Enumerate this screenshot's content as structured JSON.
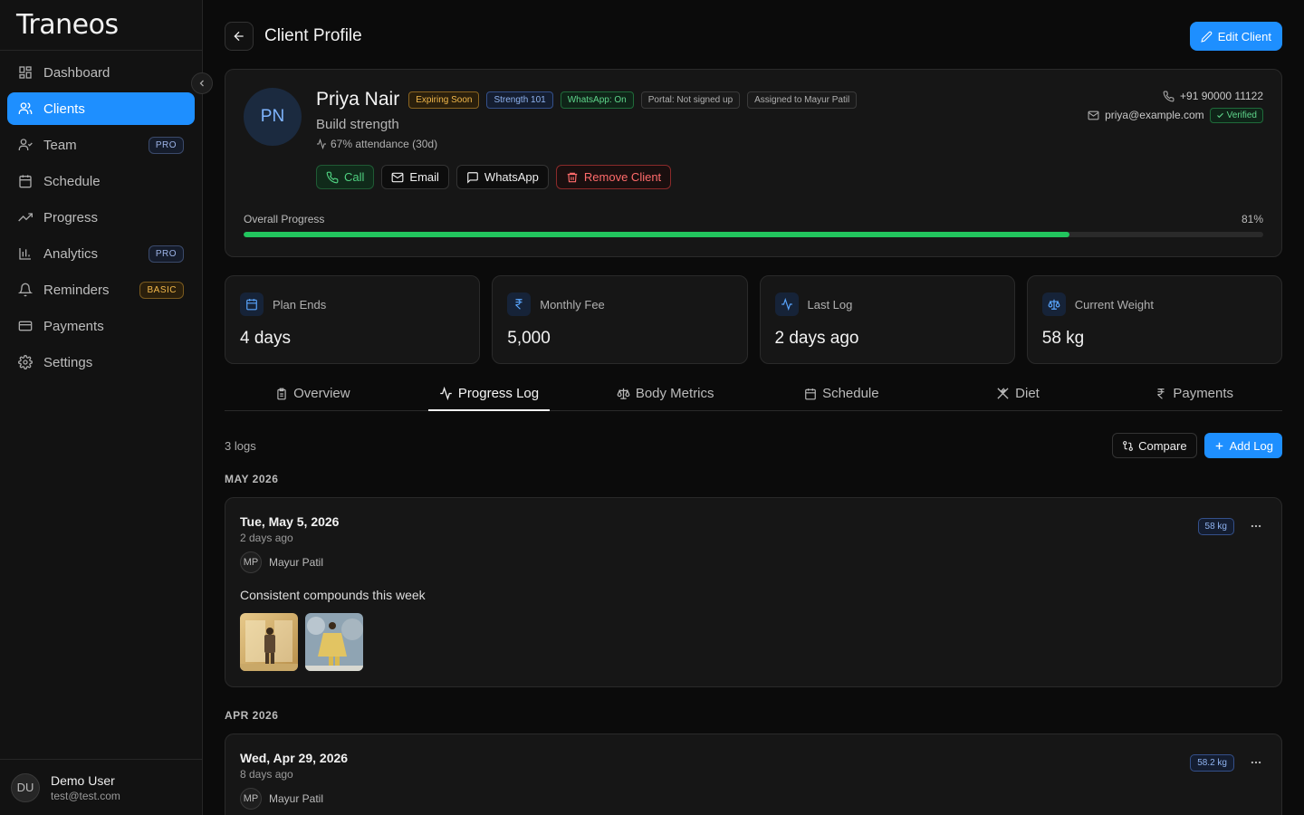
{
  "app": {
    "name": "Traneos"
  },
  "sidebar": {
    "items": [
      {
        "label": "Dashboard",
        "icon": "dashboard-icon",
        "badge": "",
        "active": false
      },
      {
        "label": "Clients",
        "icon": "users-icon",
        "badge": "",
        "active": true
      },
      {
        "label": "Team",
        "icon": "team-icon",
        "badge": "PRO",
        "active": false
      },
      {
        "label": "Schedule",
        "icon": "calendar-icon",
        "badge": "",
        "active": false
      },
      {
        "label": "Progress",
        "icon": "trending-up-icon",
        "badge": "",
        "active": false
      },
      {
        "label": "Analytics",
        "icon": "bar-chart-icon",
        "badge": "PRO",
        "active": false
      },
      {
        "label": "Reminders",
        "icon": "bell-icon",
        "badge": "BASIC",
        "active": false
      },
      {
        "label": "Payments",
        "icon": "credit-card-icon",
        "badge": "",
        "active": false
      },
      {
        "label": "Settings",
        "icon": "gear-icon",
        "badge": "",
        "active": false
      }
    ],
    "user": {
      "initials": "DU",
      "name": "Demo User",
      "email": "test@test.com"
    }
  },
  "header": {
    "title": "Client Profile",
    "edit_label": "Edit Client"
  },
  "client": {
    "initials": "PN",
    "name": "Priya Nair",
    "tags": [
      {
        "label": "Expiring Soon",
        "style": "amber"
      },
      {
        "label": "Strength 101",
        "style": "blue"
      },
      {
        "label": "WhatsApp: On",
        "style": "green"
      },
      {
        "label": "Portal: Not signed up",
        "style": "grey"
      },
      {
        "label": "Assigned to Mayur Patil",
        "style": "grey"
      }
    ],
    "goal": "Build strength",
    "attendance": "67% attendance (30d)",
    "phone": "+91 90000 11122",
    "email": "priya@example.com",
    "verified_label": "Verified",
    "actions": {
      "call": "Call",
      "email": "Email",
      "whatsapp": "WhatsApp",
      "remove": "Remove Client"
    },
    "progress": {
      "label": "Overall Progress",
      "value_text": "81%",
      "value": 81
    }
  },
  "stats": [
    {
      "label": "Plan Ends",
      "value": "4 days",
      "icon": "calendar-icon"
    },
    {
      "label": "Monthly Fee",
      "value": "5,000",
      "icon": "rupee-icon"
    },
    {
      "label": "Last Log",
      "value": "2 days ago",
      "icon": "activity-icon"
    },
    {
      "label": "Current Weight",
      "value": "58 kg",
      "icon": "scale-icon"
    }
  ],
  "tabs": [
    {
      "label": "Overview",
      "icon": "clipboard-icon",
      "active": false
    },
    {
      "label": "Progress Log",
      "icon": "activity-icon",
      "active": true
    },
    {
      "label": "Body Metrics",
      "icon": "scale-icon",
      "active": false
    },
    {
      "label": "Schedule",
      "icon": "calendar-icon",
      "active": false
    },
    {
      "label": "Diet",
      "icon": "utensils-icon",
      "active": false
    },
    {
      "label": "Payments",
      "icon": "rupee-icon",
      "active": false
    }
  ],
  "logs": {
    "count": "3 logs",
    "compare_label": "Compare",
    "add_label": "Add Log",
    "groups": [
      {
        "month": "MAY 2026",
        "entries": [
          {
            "date": "Tue, May 5, 2026",
            "relative": "2 days ago",
            "author_initials": "MP",
            "author": "Mayur Patil",
            "weight": "58 kg",
            "note": "Consistent compounds this week",
            "photos": 2
          }
        ]
      },
      {
        "month": "APR 2026",
        "entries": [
          {
            "date": "Wed, Apr 29, 2026",
            "relative": "8 days ago",
            "author_initials": "MP",
            "author": "Mayur Patil",
            "weight": "58.2 kg",
            "note": "",
            "photos": 0
          }
        ]
      }
    ]
  },
  "colors": {
    "accent": "#1e8fff",
    "progress": "#22c55e",
    "background": "#0b0b0b",
    "card": "#161616"
  }
}
